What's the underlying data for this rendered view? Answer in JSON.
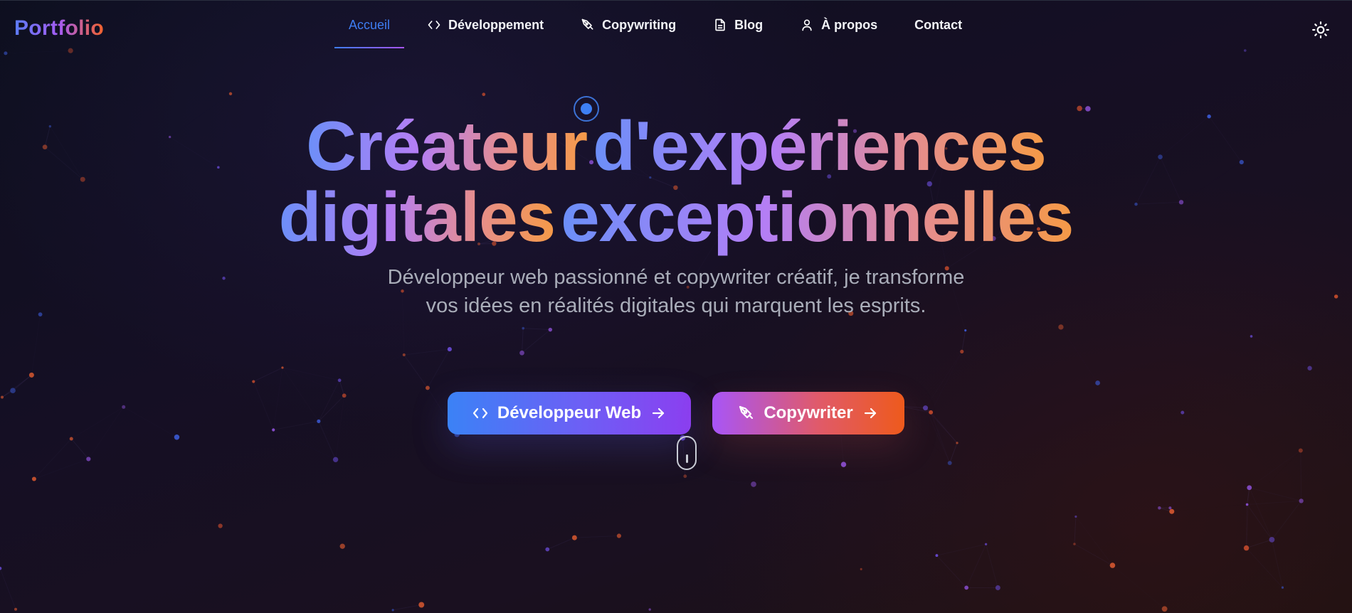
{
  "header": {
    "logo": "Portfolio",
    "nav": [
      {
        "label": "Accueil",
        "icon": "",
        "active": true
      },
      {
        "label": "Développement",
        "icon": "code-icon",
        "active": false
      },
      {
        "label": "Copywriting",
        "icon": "pen-nib-icon",
        "active": false
      },
      {
        "label": "Blog",
        "icon": "document-icon",
        "active": false
      },
      {
        "label": "À propos",
        "icon": "user-icon",
        "active": false
      },
      {
        "label": "Contact",
        "icon": "",
        "active": false
      }
    ],
    "theme_toggle_icon": "sun-icon"
  },
  "hero": {
    "title_line1_a": "Créateur",
    "title_line1_b": "d'expériences",
    "title_line2_a": "digitales",
    "title_line2_b": "exceptionnelles",
    "subtitle": "Développeur web passionné et copywriter créatif, je transforme vos idées en réalités digitales qui marquent les esprits.",
    "cta_dev": "Développeur Web",
    "cta_copy": "Copywriter"
  },
  "colors": {
    "accent_blue": "#3e7df2",
    "accent_purple": "#a855f7",
    "accent_orange": "#ee5a1c",
    "background": "#120f1f"
  }
}
